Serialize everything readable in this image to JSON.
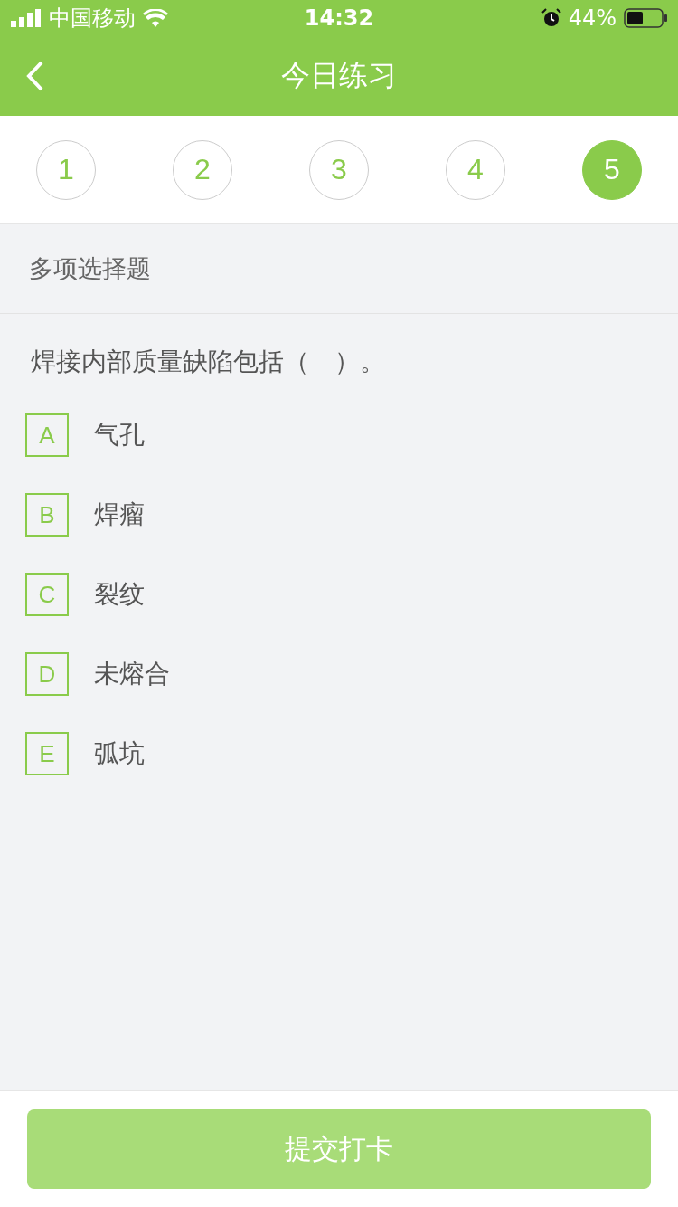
{
  "status_bar": {
    "carrier": "中国移动",
    "time": "14:32",
    "battery": "44%"
  },
  "nav": {
    "title": "今日练习"
  },
  "steps": [
    {
      "label": "1",
      "selected": false
    },
    {
      "label": "2",
      "selected": false
    },
    {
      "label": "3",
      "selected": false
    },
    {
      "label": "4",
      "selected": false
    },
    {
      "label": "5",
      "selected": true
    }
  ],
  "section_title": "多项选择题",
  "question": "焊接内部质量缺陷包括（　）。",
  "options": [
    {
      "letter": "A",
      "text": "气孔",
      "checked": false
    },
    {
      "letter": "B",
      "text": "焊瘤",
      "checked": false
    },
    {
      "letter": "C",
      "text": "裂纹",
      "checked": false
    },
    {
      "letter": "D",
      "text": "未熔合",
      "checked": false
    },
    {
      "letter": "E",
      "text": "弧坑",
      "checked": false
    }
  ],
  "submit": {
    "label": "提交打卡",
    "disabled": true
  }
}
